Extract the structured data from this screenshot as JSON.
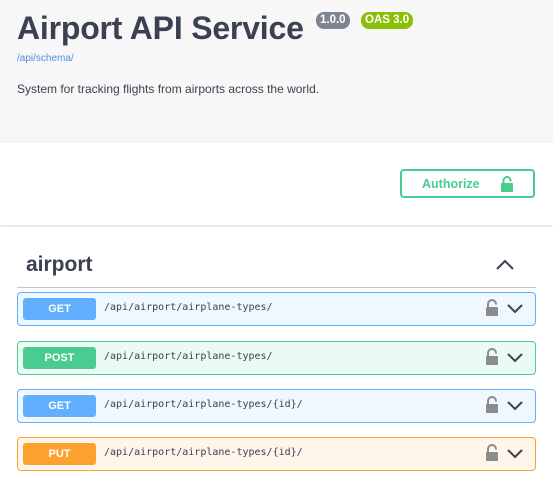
{
  "info": {
    "title": "Airport API Service",
    "version_badge": "1.0.0",
    "oas_badge": "OAS 3.0",
    "schema_link": "/api/schema/",
    "description": "System for tracking flights from airports across the world."
  },
  "authorize": {
    "label": "Authorize",
    "icon": "lock-icon"
  },
  "tag": {
    "name": "airport",
    "expanded": true
  },
  "operations": [
    {
      "method": "GET",
      "path": "/api/airport/airplane-types/"
    },
    {
      "method": "POST",
      "path": "/api/airport/airplane-types/"
    },
    {
      "method": "GET",
      "path": "/api/airport/airplane-types/{id}/"
    },
    {
      "method": "PUT",
      "path": "/api/airport/airplane-types/{id}/"
    }
  ],
  "colors": {
    "get": "#61affe",
    "post": "#49cc90",
    "put": "#fca130",
    "text": "#3b4151",
    "link": "#4990e2"
  }
}
